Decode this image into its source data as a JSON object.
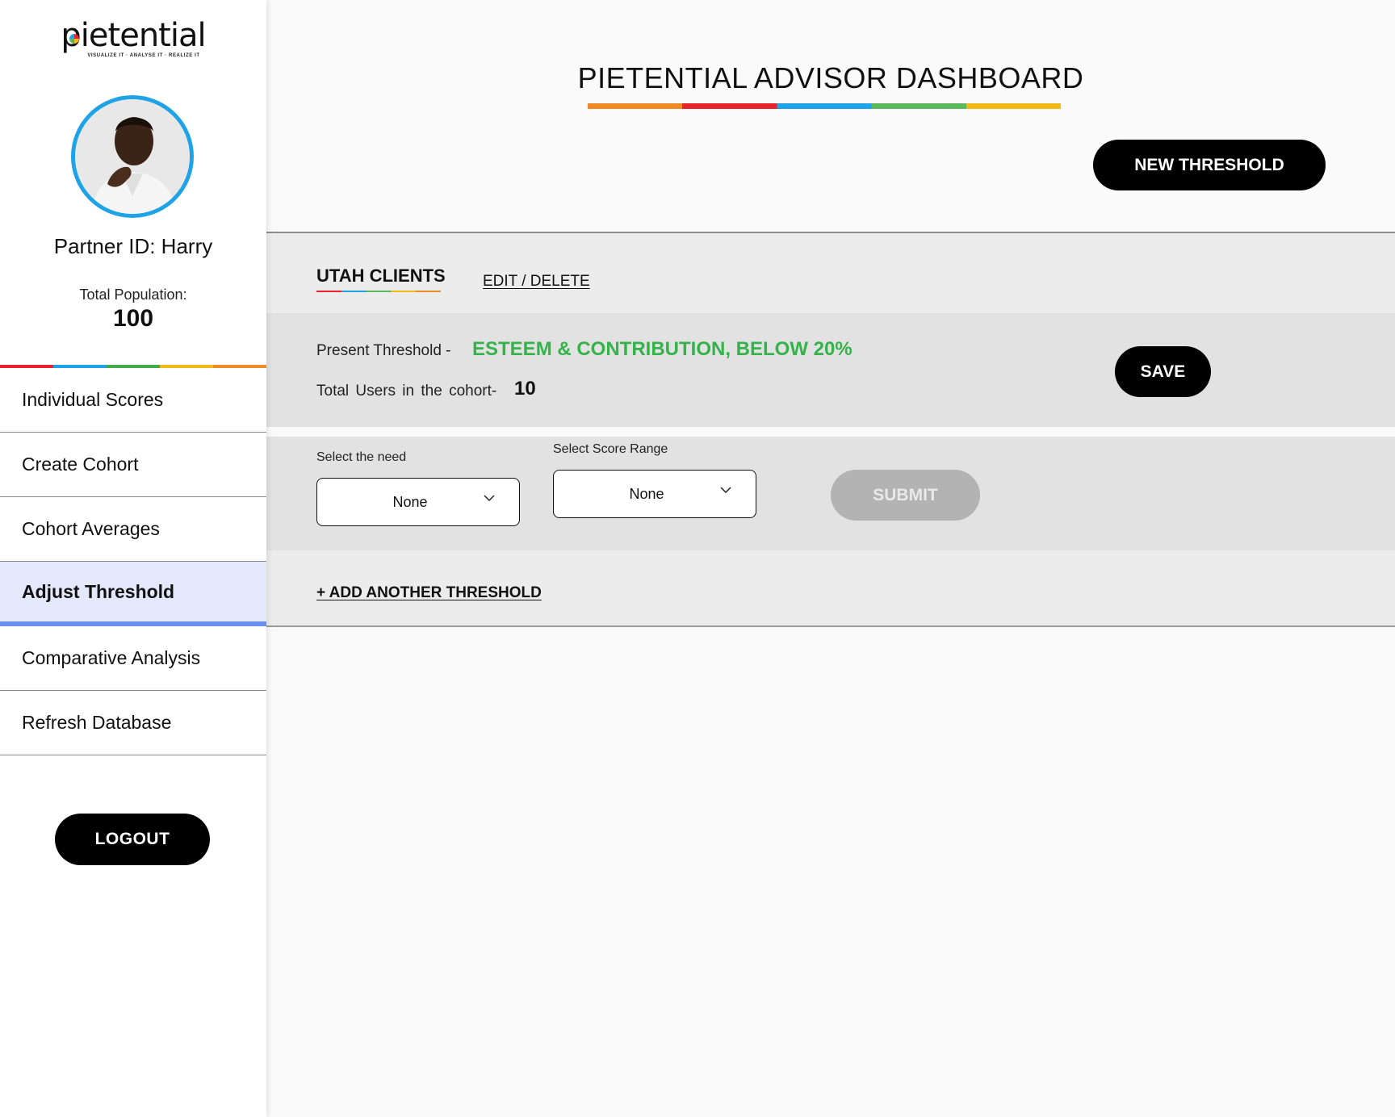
{
  "brand": {
    "name": "pietential",
    "tagline": "VISUALIZE IT · ANALYSE IT · REALIZE IT"
  },
  "sidebar": {
    "partner_id": "Partner ID: Harry",
    "population_label": "Total Population:",
    "population_value": "100",
    "items": [
      {
        "label": "Individual Scores",
        "active": false
      },
      {
        "label": "Create Cohort",
        "active": false
      },
      {
        "label": "Cohort Averages",
        "active": false
      },
      {
        "label": "Adjust Threshold",
        "active": true
      },
      {
        "label": "Comparative Analysis",
        "active": false
      },
      {
        "label": "Refresh Database",
        "active": false
      }
    ],
    "logout_label": "LOGOUT"
  },
  "header": {
    "title": "PIETENTIAL ADVISOR DASHBOARD",
    "new_threshold_label": "NEW THRESHOLD"
  },
  "cohort": {
    "name": "UTAH CLIENTS",
    "edit_label": "EDIT / DELETE"
  },
  "threshold": {
    "present_label": "Present Threshold -",
    "present_value": "ESTEEM & CONTRIBUTION, BELOW 20%",
    "users_label": "Total Users in the cohort-",
    "users_value": "10",
    "save_label": "SAVE"
  },
  "form": {
    "need_label": "Select the need",
    "need_value": "None",
    "range_label": "Select Score Range",
    "range_value": "None",
    "submit_label": "SUBMIT"
  },
  "add_threshold_label": "+ ADD ANOTHER THRESHOLD",
  "colors": {
    "accent_blue": "#1ea4e6",
    "active_nav_bg": "#e3e9fb",
    "active_nav_bar": "#6b8ff0",
    "threshold_green": "#35b24a",
    "button_black": "#000000",
    "button_disabled": "#b3b3b3"
  }
}
